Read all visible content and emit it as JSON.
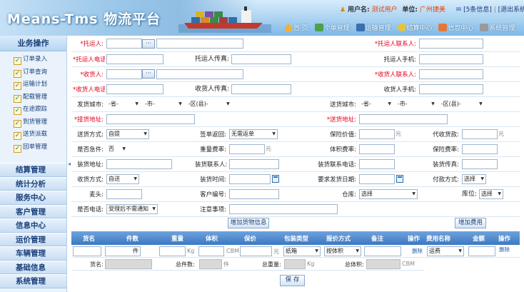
{
  "header": {
    "logo": "Means-Tms 物流平台",
    "user_label": "用户名:",
    "user_value": "测试用户",
    "unit_label": "单位:",
    "unit_value": "广州捷美",
    "messages": "[5条信息]",
    "logout": "[退出系统]",
    "nav": [
      "首 页",
      "个单管理",
      "运输管理",
      "结算中心",
      "信息中心",
      "系统管理"
    ]
  },
  "sidebar": {
    "title": "业务操作",
    "items": [
      "订单录入",
      "订单查询",
      "运输计划",
      "配载管理",
      "在途跟踪",
      "到货管理",
      "送货派载",
      "回单管理"
    ],
    "groups": [
      "结算管理",
      "统计分析",
      "服务中心",
      "客户管理",
      "信息中心",
      "运价管理",
      "车辆管理",
      "基础信息",
      "系统管理"
    ]
  },
  "form": {
    "shipper": "*托运人:",
    "shipper_contact": "*托运人联系人:",
    "shipper_phone": "*托运人电话:",
    "shipper_fax": "托运人传真:",
    "shipper_mobile": "托运人手机:",
    "consignee": "*收货人:",
    "consignee_contact": "*收货人联系人:",
    "consignee_phone": "*收货人电话:",
    "consignee_fax": "收货人传真:",
    "consignee_mobile": "收货人手机:",
    "from_city": "发货城市:",
    "to_city": "送货城市:",
    "province": "-省-",
    "city": "-市-",
    "district": "-区(县)-",
    "pickup_addr": "*接货地址:",
    "delivery_addr": "*送货地址:",
    "delivery_mode": "送货方式:",
    "delivery_mode_val": "自提",
    "receipt_return": "签单返回:",
    "receipt_return_val": "无需返单",
    "insured_value": "保险价值:",
    "yuan": "元",
    "cod": "代收货款:",
    "urgent": "是否急件:",
    "urgent_val": "否",
    "weight_rate": "重量费率:",
    "volume_rate": "体积费率:",
    "insure_rate": "保险费率:",
    "load_addr": "装货地址:",
    "load_contact": "装货联系人:",
    "load_phone": "装货联系电话:",
    "load_fax": "装货传真:",
    "receive_mode": "收货方式:",
    "receive_mode_val": "自送",
    "load_time": "装货时间:",
    "req_date": "要求发货日期:",
    "pay_mode": "付款方式:",
    "choose": "选择",
    "head": "麦头:",
    "cust_no": "客户编号:",
    "warehouse": "仓库:",
    "location": "库位:",
    "wait_notice": "是否电话:",
    "wait_notice_val": "受理后不需通知",
    "remarks": "注意事项:"
  },
  "buttons": {
    "add_goods": "增加货物信息",
    "add_fee": "增加费用",
    "save": "保 存"
  },
  "goods_grid": {
    "headers": [
      "货名",
      "件数",
      "重量",
      "体积",
      "保价",
      "包装类型",
      "报价方式",
      "备注",
      "操作"
    ],
    "row": {
      "pieces_unit": "件",
      "weight_unit": "Kg",
      "volume_unit": "CBM",
      "value_unit": "元",
      "pack": "纸箱",
      "quote": "按体积",
      "op": "删除"
    },
    "summary": {
      "name": "货名:",
      "total_pieces": "总件数:",
      "pieces_unit": "件",
      "total_weight": "总重量:",
      "weight_unit": "Kg",
      "total_volume": "总体积:",
      "volume_unit": "CBM"
    }
  },
  "fee_grid": {
    "headers": [
      "费用名称",
      "金额",
      "操作"
    ],
    "row": {
      "name": "运费",
      "op": "删除"
    }
  }
}
